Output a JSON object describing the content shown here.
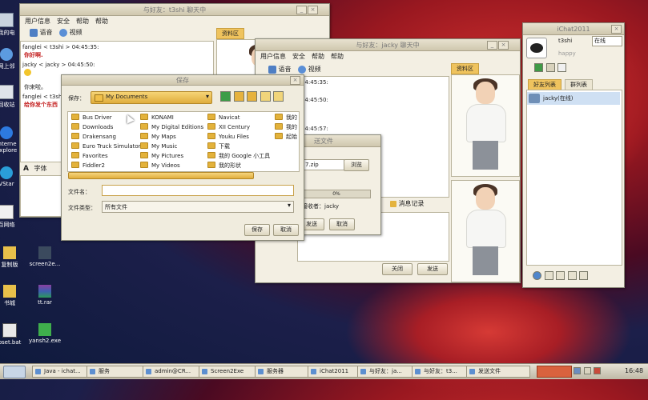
{
  "desktop": {
    "icons": [
      {
        "label": "我的电"
      },
      {
        "label": "网上邻"
      },
      {
        "label": "回收站"
      },
      {
        "label": "Interne Explore"
      },
      {
        "label": "VStar"
      },
      {
        "label": "百网络"
      },
      {
        "label": "复制版"
      },
      {
        "label": "screen2e..."
      },
      {
        "label": "书城"
      },
      {
        "label": "tt.rar"
      },
      {
        "label": "pset.bat"
      },
      {
        "label": "yansh2.exe"
      }
    ]
  },
  "chat_window_left": {
    "title": "与好友：t3shi 聊天中",
    "menu": [
      "用户信息",
      "安全",
      "帮助",
      "帮助"
    ],
    "toolbar": {
      "voice": "语音",
      "video": "视频"
    },
    "messages": [
      {
        "header": "fanglei < t3shi > 04:45:35:",
        "body": "你好啊."
      },
      {
        "header": "jacky < jacky > 04:45:50:",
        "body": ""
      },
      {
        "header": "",
        "body": "你来啦。"
      },
      {
        "header": "fanglei < t3shi > 04:4",
        "body": "给你发个东西"
      }
    ],
    "profile_tab": "资料区",
    "font_label": "字体"
  },
  "save_dialog": {
    "title": "保存",
    "save_in_label": "保存：",
    "location": "My Documents",
    "folders": [
      [
        "Bus Driver",
        "Downloads",
        "Drakensang",
        "Euro Truck Simulator",
        "Favorites",
        "Fiddler2"
      ],
      [
        "KONAMI",
        "My Digital Editions",
        "My Maps",
        "My Music",
        "My Pictures",
        "My Videos"
      ],
      [
        "Navicat",
        "XII Century",
        "Youku Files",
        "下载",
        "我的 Google 小工具",
        "我的形状"
      ],
      [
        "我的",
        "我的",
        "起始"
      ]
    ],
    "filename_label": "文件名：",
    "filename_value": "",
    "filetype_label": "文件类型：",
    "filetype_value": "所有文件",
    "save_button": "保存",
    "cancel_button": "取消"
  },
  "chat_window_right": {
    "title": "与好友：jacky 聊天中",
    "menu": [
      "用户信息",
      "安全",
      "帮助",
      "帮助"
    ],
    "toolbar": {
      "voice": "语音",
      "video": "视频"
    },
    "timestamps": [
      "04:45:35:",
      "04:45:50:",
      "04:45:57:"
    ],
    "profile_tab": "资料区",
    "history_label": "消息记录",
    "close_button": "关闭",
    "send_button": "发送"
  },
  "file_transfer": {
    "title": "送文件",
    "filename": "7.zip",
    "browse_button": "浏览",
    "progress_text": "0%",
    "receiver_label": "接收者：jacky",
    "send_button": "发送",
    "cancel_button": "取消"
  },
  "ichat_main": {
    "title": "iChat2011",
    "username": "t3shi",
    "status": "在线",
    "signature": "happy",
    "tabs": [
      "好友列表",
      "群列表"
    ],
    "friends": [
      {
        "name": "jacky(在线)"
      }
    ]
  },
  "taskbar": {
    "items": [
      "Java - ichat...",
      "服务",
      "admin@CR...",
      "Screen2Exe",
      "服务器",
      "iChat2011",
      "与好友：ja...",
      "与好友：t3...",
      "发送文件"
    ],
    "clock": "16:48"
  }
}
